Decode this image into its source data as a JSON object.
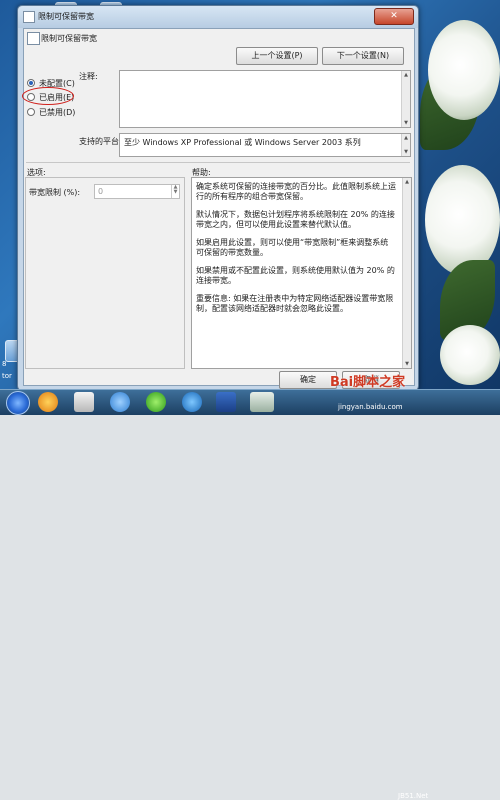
{
  "window": {
    "title": "限制可保留带宽",
    "close_glyph": "✕"
  },
  "header": {
    "title": "限制可保留带宽"
  },
  "nav": {
    "prev_label": "上一个设置(P)",
    "next_label": "下一个设置(N)"
  },
  "state": {
    "options": [
      {
        "label": "未配置(C)",
        "selected": true
      },
      {
        "label": "已启用(E)",
        "selected": false
      },
      {
        "label": "已禁用(D)",
        "selected": false
      }
    ]
  },
  "comment": {
    "label": "注释:",
    "value": ""
  },
  "supported": {
    "label": "支持的平台:",
    "value": "至少 Windows XP Professional 或 Windows Server 2003 系列"
  },
  "options_section": {
    "label": "选项:",
    "bandwidth_label": "带宽限制 (%):",
    "bandwidth_value": "0"
  },
  "help_section": {
    "label": "帮助:",
    "paragraphs": [
      "确定系统可保留的连接带宽的百分比。此值限制系统上运行的所有程序的组合带宽保留。",
      "默认情况下，数据包计划程序将系统限制在 20% 的连接带宽之内，但可以使用此设置来替代默认值。",
      "如果启用此设置，则可以使用“带宽限制”框来调整系统可保留的带宽数量。",
      "如果禁用或不配置此设置，则系统使用默认值为 20% 的连接带宽。",
      "重要信息: 如果在注册表中为特定网络适配器设置带宽限制，配置该网络适配器时就会忽略此设置。"
    ]
  },
  "footer": {
    "ok_label": "确定",
    "cancel_label": "取消"
  },
  "watermark": {
    "logo": "Bai脚本之家",
    "site": "JB51.Net",
    "url": "jingyan.baidu.com"
  },
  "desktop": {
    "icon_labels": [
      "8",
      "tor"
    ]
  },
  "colors": {
    "annotation": "#d0201c",
    "accent": "#2a62b8"
  }
}
